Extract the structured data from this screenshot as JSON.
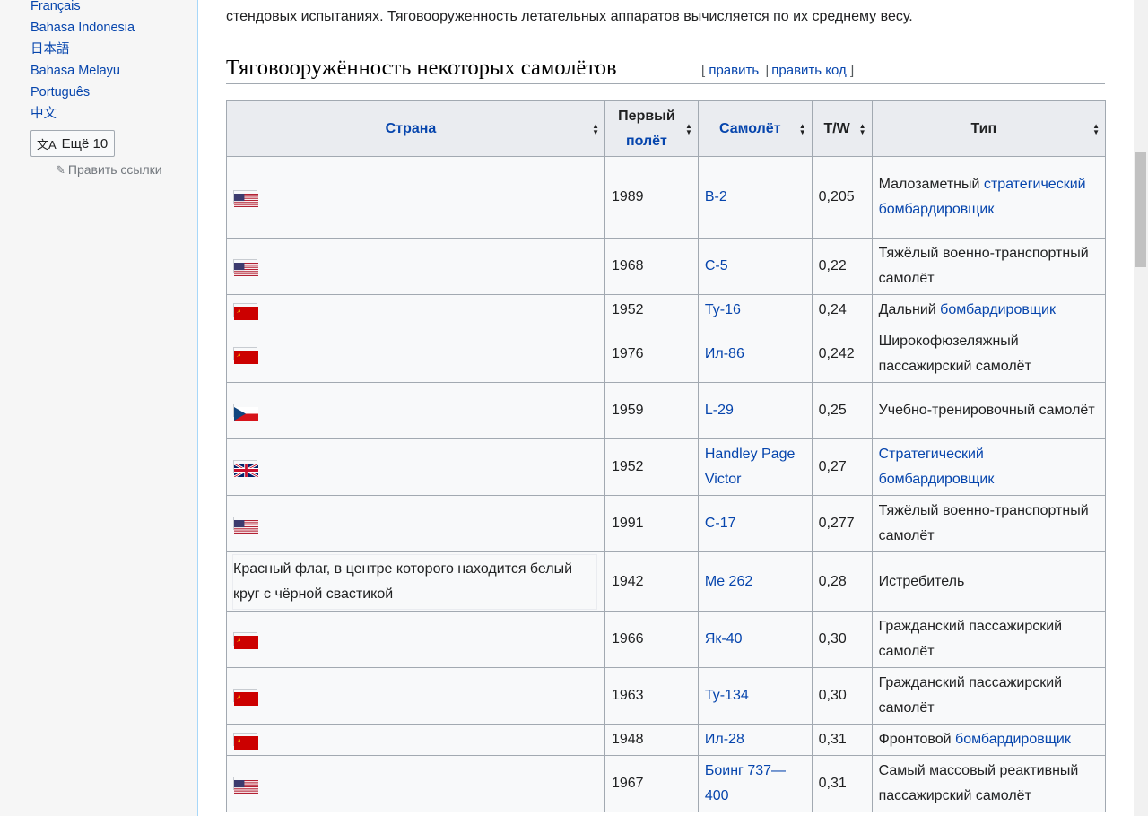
{
  "sidebar": {
    "languages": [
      "Français",
      "Bahasa Indonesia",
      "日本語",
      "Bahasa Melayu",
      "Português",
      "中文"
    ],
    "more_button": "Ещё 10",
    "edit_links": "Править ссылки"
  },
  "intro_text": "стендовых испытаниях. Тяговооруженность летательных аппаратов вычисляется по их среднему весу.",
  "section": {
    "title": "Тяговооружённость некоторых самолётов",
    "edit_open": "[",
    "edit_label": "править",
    "edit_sep": "|",
    "edit_code_label": "править код",
    "edit_close": "]"
  },
  "table": {
    "headers": [
      "Страна",
      "Первый полёт",
      "Самолёт",
      "T/W",
      "Тип"
    ],
    "header_first_flight_line1": "Первый",
    "header_first_flight_line2": "полёт",
    "rows": [
      {
        "flag": "us",
        "year": "1989",
        "plane": "B-2",
        "tw": "0,205",
        "type_pre": "Малозаметный",
        "type_link": "стратегический бомбардировщик",
        "type_post": ""
      },
      {
        "flag": "us",
        "year": "1968",
        "plane": "C-5",
        "tw": "0,22",
        "type_pre": "Тяжёлый военно-транспортный самолёт",
        "type_link": "",
        "type_post": ""
      },
      {
        "flag": "su",
        "year": "1952",
        "plane": "Ту-16",
        "tw": "0,24",
        "type_pre": "Дальний",
        "type_link": "бомбардировщик",
        "type_post": ""
      },
      {
        "flag": "su",
        "year": "1976",
        "plane": "Ил-86",
        "tw": "0,242",
        "type_pre": "Широкофюзеляжный пассажирский самолёт",
        "type_link": "",
        "type_post": ""
      },
      {
        "flag": "cz",
        "year": "1959",
        "plane": "L-29",
        "tw": "0,25",
        "type_pre": "Учебно-тренировочный самолёт",
        "type_link": "",
        "type_post": ""
      },
      {
        "flag": "uk",
        "year": "1952",
        "plane": "Handley Page Victor",
        "tw": "0,27",
        "type_pre": "",
        "type_link": "Стратегический бомбардировщик",
        "type_post": ""
      },
      {
        "flag": "us",
        "year": "1991",
        "plane": "C-17",
        "tw": "0,277",
        "type_pre": "Тяжёлый военно-транспортный самолёт",
        "type_link": "",
        "type_post": ""
      },
      {
        "flag": "broken",
        "flag_alt": "Красный флаг, в центре которого находится белый круг с чёрной свастикой",
        "year": "1942",
        "plane": "Me 262",
        "tw": "0,28",
        "type_pre": "Истребитель",
        "type_link": "",
        "type_post": ""
      },
      {
        "flag": "su",
        "year": "1966",
        "plane": "Як-40",
        "tw": "0,30",
        "type_pre": "Гражданский пассажирский самолёт",
        "type_link": "",
        "type_post": ""
      },
      {
        "flag": "su",
        "year": "1963",
        "plane": "Ту-134",
        "tw": "0,30",
        "type_pre": "Гражданский пассажирский самолёт",
        "type_link": "",
        "type_post": ""
      },
      {
        "flag": "su",
        "year": "1948",
        "plane": "Ил-28",
        "tw": "0,31",
        "type_pre": "Фронтовой",
        "type_link": "бомбардировщик",
        "type_post": ""
      },
      {
        "flag": "us",
        "year": "1967",
        "plane": "Боинг 737—400",
        "tw": "0,31",
        "type_pre": "Самый массовый реактивный пассажирский самолёт",
        "type_link": "",
        "type_post": ""
      }
    ]
  },
  "colors": {
    "link": "#0645ad",
    "border": "#a2a9b1",
    "header_bg": "#eaecf0",
    "cell_bg": "#f8f9fa",
    "sidebar_bg": "#f6f6f6"
  }
}
